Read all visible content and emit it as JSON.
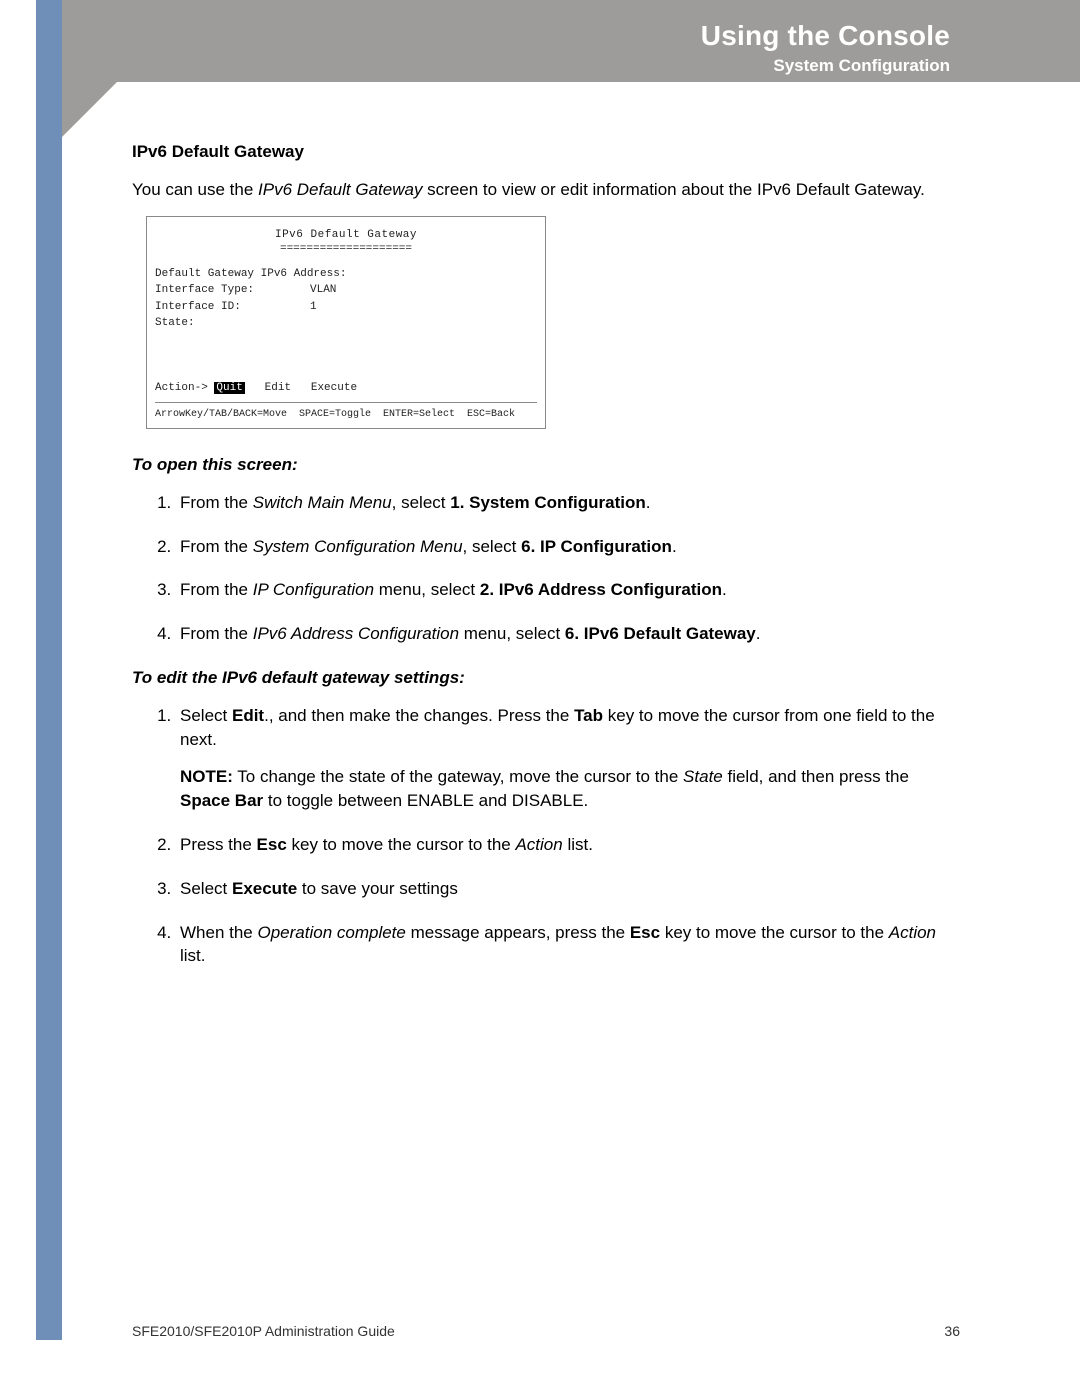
{
  "header": {
    "title": "Using the Console",
    "subtitle": "System Configuration"
  },
  "section_heading": "IPv6 Default Gateway",
  "intro": {
    "pre": "You can use the ",
    "em": "IPv6 Default Gateway",
    "post": " screen to view or edit information about the IPv6 Default Gateway."
  },
  "console": {
    "title": "IPv6 Default Gateway",
    "underline": "====================",
    "rows": [
      {
        "label": "Default Gateway IPv6 Address:",
        "value": ""
      },
      {
        "label": "",
        "value": ""
      },
      {
        "label": "Interface Type:",
        "value": "VLAN"
      },
      {
        "label": "Interface ID:",
        "value": "1"
      },
      {
        "label": "State:",
        "value": ""
      }
    ],
    "action_prefix": "Action-> ",
    "action_selected": "Quit",
    "action_rest": "   Edit   Execute",
    "help": "ArrowKey/TAB/BACK=Move  SPACE=Toggle  ENTER=Select  ESC=Back"
  },
  "open_heading": "To open this screen:",
  "open_steps": [
    {
      "pre": "From the ",
      "em": "Switch Main Menu",
      "mid": ", select ",
      "b": "1. System Configuration",
      "post": "."
    },
    {
      "pre": "From the ",
      "em": "System Configuration Menu",
      "mid": ", select ",
      "b": "6. IP Configuration",
      "post": "."
    },
    {
      "pre": "From the ",
      "em": "IP Configuration",
      "mid": " menu, select ",
      "b": "2. IPv6 Address Configuration",
      "post": "."
    },
    {
      "pre": "From the ",
      "em": "IPv6 Address Configuration",
      "mid": " menu, select ",
      "b": "6. IPv6 Default Gateway",
      "post": "."
    }
  ],
  "edit_heading": "To edit the IPv6 default gateway settings:",
  "edit_step1": {
    "pre": "Select ",
    "b": "Edit",
    "mid": "., and then make the changes. Press the ",
    "b2": "Tab",
    "post": " key to move the cursor from one field to the next."
  },
  "note": {
    "label": "NOTE:",
    "a": " To change the state of the gateway, move the cursor to the ",
    "em": "State",
    "b_spacebar": "Space Bar",
    "mid": " field, and then press the ",
    "tail": " to toggle between ENABLE and DISABLE."
  },
  "edit_step2": {
    "pre": "Press the ",
    "b": "Esc",
    "mid": " key to move the cursor to the ",
    "em": "Action",
    "post": " list."
  },
  "edit_step3": {
    "pre": "Select ",
    "b": "Execute",
    "post": " to save your settings"
  },
  "edit_step4": {
    "pre": "When the ",
    "em": "Operation complete",
    "mid": " message appears, press the ",
    "b": "Esc",
    "mid2": " key to move the cursor to the ",
    "em2": "Action",
    "post": " list."
  },
  "footer": {
    "left": "SFE2010/SFE2010P Administration Guide",
    "right": "36"
  }
}
